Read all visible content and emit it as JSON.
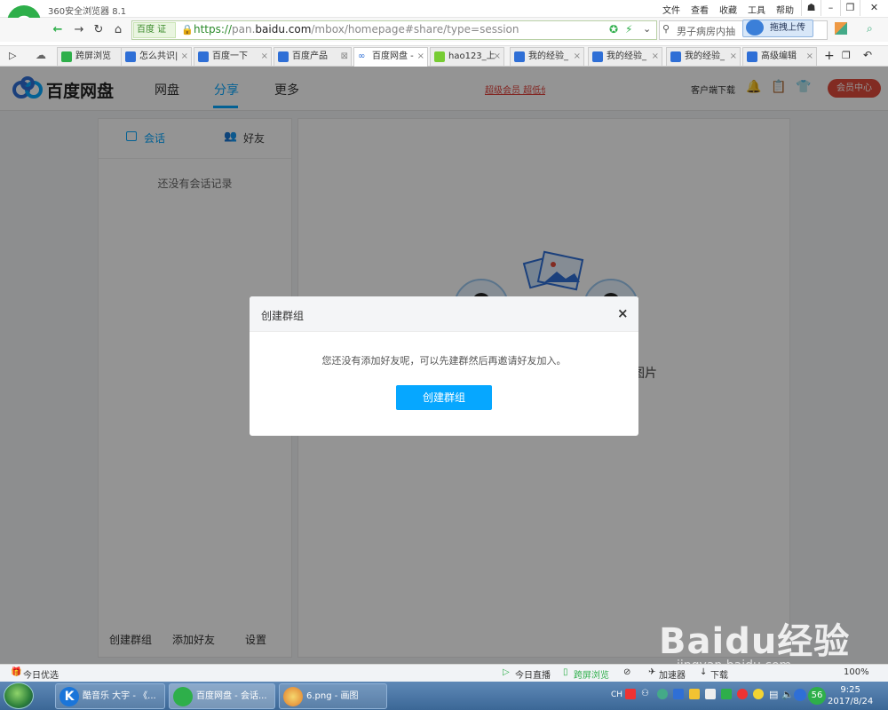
{
  "browser": {
    "app_name": "360安全浏览器 8.1",
    "menu": [
      "文件",
      "查看",
      "收藏",
      "工具",
      "帮助"
    ],
    "cert_label": "百度 证",
    "url_scheme": "https://",
    "url_host_pre": "pan.",
    "url_host": "baidu.com",
    "url_path": "/mbox/homepage#share/type=session",
    "search_text": "男子病房内抽",
    "upload_label": "拖拽上传",
    "tabs": [
      {
        "label": "跨屏浏览"
      },
      {
        "label": "怎么共识|"
      },
      {
        "label": "百度一下"
      },
      {
        "label": "百度产品"
      },
      {
        "label": "百度网盘 -"
      },
      {
        "label": "hao123_上"
      },
      {
        "label": "我的经验_"
      },
      {
        "label": "我的经验_"
      },
      {
        "label": "我的经验_"
      },
      {
        "label": "高级编辑"
      }
    ]
  },
  "pan": {
    "logo_text": "百度网盘",
    "nav": [
      "网盘",
      "分享",
      "更多"
    ],
    "vip_text": "超级会员 超低价",
    "client_download": "客户端下载",
    "member_center": "会员中心",
    "left_tabs": [
      "会话",
      "好友"
    ],
    "empty_text": "还没有会话记录",
    "bottom_actions": [
      "创建群组",
      "添加好友",
      "设置"
    ],
    "photo_text": "图片"
  },
  "modal": {
    "title": "创建群组",
    "close": "×",
    "message": "您还没有添加好友呢，可以先建群然后再邀请好友加入。",
    "button": "创建群组"
  },
  "statusbar": {
    "left": "今日优选",
    "items": [
      "今日直播",
      "跨屏浏览",
      "加速器",
      "下载"
    ],
    "zoom": "100%"
  },
  "taskbar": {
    "tasks": [
      "酷音乐 大宇 - 《...",
      "百度网盘 - 会话...",
      "6.png - 画图"
    ],
    "ime": "CH",
    "time": "9:25",
    "date": "2017/8/24",
    "badge": "56"
  },
  "watermark": {
    "text": "Baidu经验",
    "url": "jingyan.baidu.com"
  }
}
